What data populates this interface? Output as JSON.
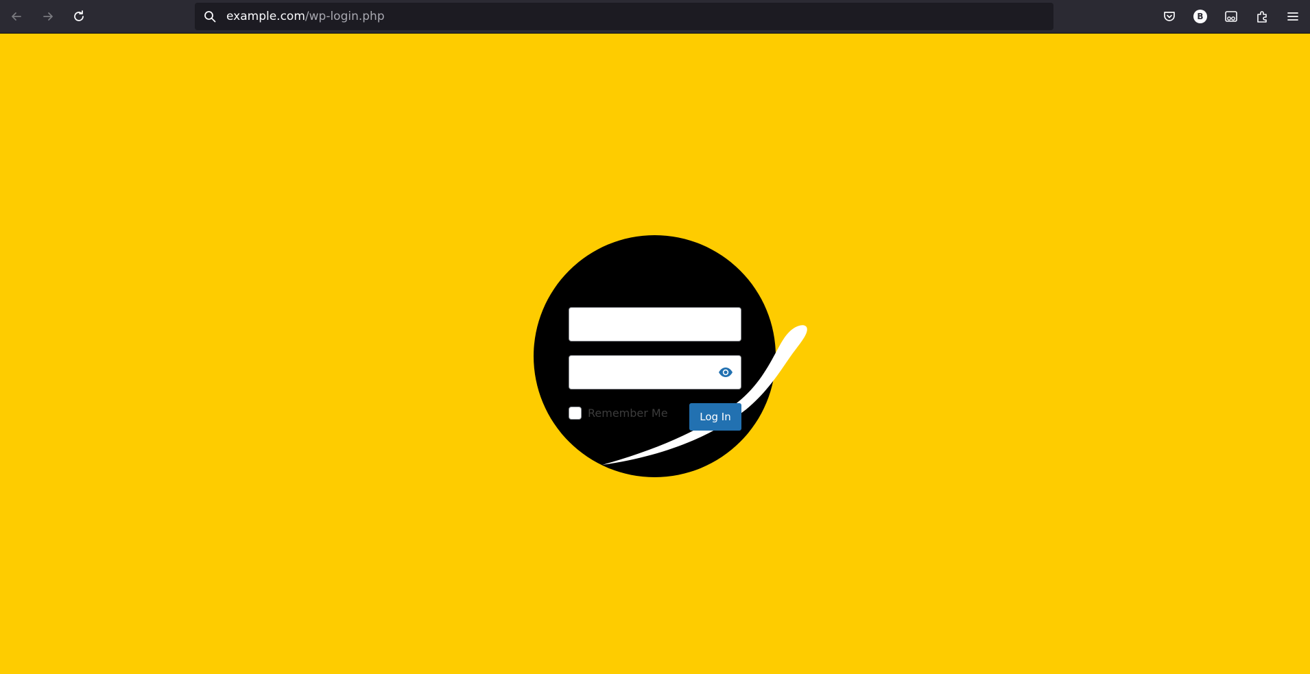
{
  "browser": {
    "url_host": "example.com",
    "url_path": "/wp-login.php",
    "account_initial": "B",
    "icons": [
      "back-icon",
      "forward-icon",
      "reload-icon",
      "search-icon",
      "pocket-icon",
      "account-icon",
      "reader-view-icon",
      "extensions-icon",
      "menu-icon"
    ]
  },
  "login": {
    "username_value": "",
    "password_value": "",
    "remember_label": "Remember Me",
    "submit_label": "Log In",
    "show_password_icon": "eye-icon"
  },
  "colors": {
    "page_background": "#fecc00",
    "circle": "#000000",
    "button": "#2271b1",
    "toolbar": "#2b2a33",
    "urlbar": "#1c1b22"
  }
}
